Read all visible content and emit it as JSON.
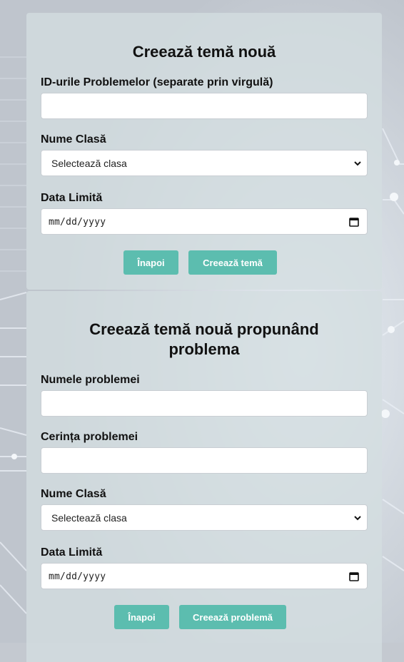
{
  "form_existing": {
    "title": "Creează temă nouă",
    "ids_label": "ID-urile Problemelor (separate prin virgulă)",
    "ids_value": "",
    "class_label": "Nume Clasă",
    "class_selected": "Selectează clasa",
    "deadline_label": "Data Limită",
    "deadline_value": "mm/dd/yyyy",
    "back_label": "Înapoi",
    "submit_label": "Creează temă"
  },
  "form_propose": {
    "title": "Creează temă nouă propunând problema",
    "name_label": "Numele problemei",
    "name_value": "",
    "statement_label": "Cerința problemei",
    "statement_value": "",
    "class_label": "Nume Clasă",
    "class_selected": "Selectează clasa",
    "deadline_label": "Data Limită",
    "deadline_value": "mm/dd/yyyy",
    "back_label": "Înapoi",
    "submit_label": "Creează problemă"
  },
  "colors": {
    "accent": "#5cbdaf",
    "card_bg": "#d3dee0",
    "page_bg": "#c4c9d0"
  },
  "icons": {
    "select_arrow": "chevron-down-icon",
    "date_picker": "calendar-icon"
  }
}
